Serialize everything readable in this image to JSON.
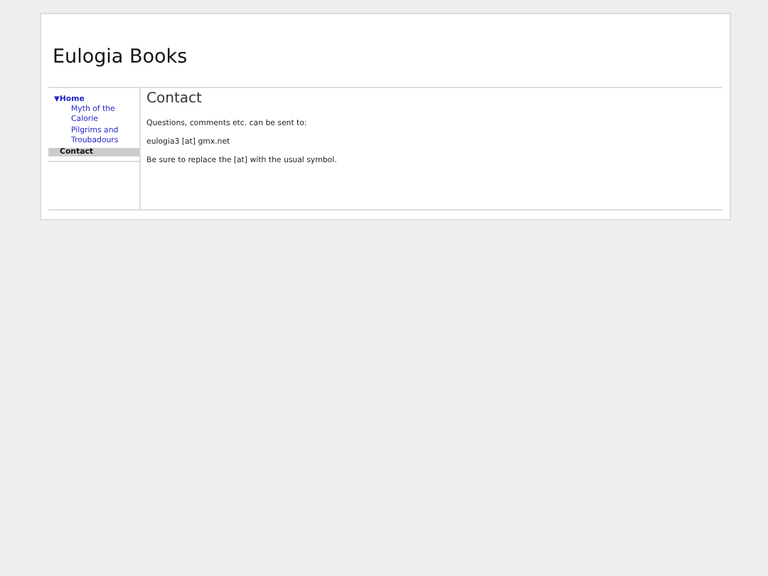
{
  "site": {
    "title": "Eulogia Books"
  },
  "nav": [
    {
      "label": "Home",
      "expanded": true,
      "selected": false,
      "toggle": "▼",
      "children": [
        {
          "label": "Myth of the Calorie",
          "selected": false
        },
        {
          "label": "Pilgrims and Troubadours",
          "selected": false
        }
      ]
    },
    {
      "label": "Contact",
      "selected": true
    }
  ],
  "content": {
    "heading": "Contact",
    "paragraphs": [
      "Questions, comments etc. can be sent to:",
      "eulogia3 [at] gmx.net",
      "Be sure to replace the [at] with the usual symbol."
    ]
  }
}
